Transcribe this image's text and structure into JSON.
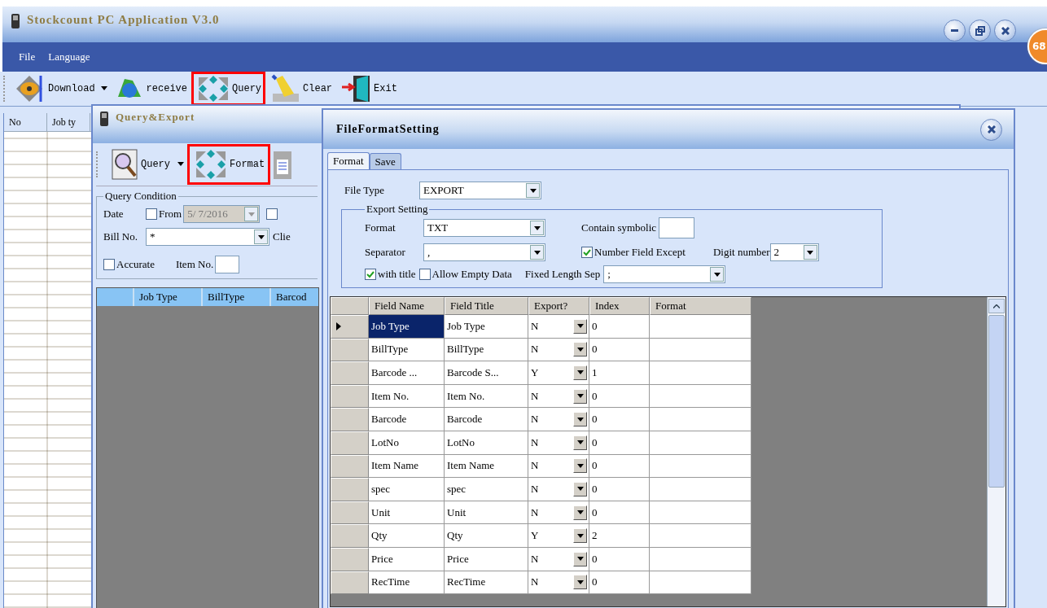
{
  "window": {
    "title": "Stockcount PC Application V3.0"
  },
  "badge": "68",
  "menu": [
    "File",
    "Language"
  ],
  "toolbar": [
    {
      "label": "Download",
      "kind": "download",
      "has_dropdown": true,
      "highlighted": false
    },
    {
      "label": "receive",
      "kind": "receive",
      "has_dropdown": false,
      "highlighted": false
    },
    {
      "label": "Query",
      "kind": "query",
      "has_dropdown": false,
      "highlighted": true
    },
    {
      "label": "Clear",
      "kind": "clear",
      "has_dropdown": false,
      "highlighted": false
    },
    {
      "label": "Exit",
      "kind": "exit",
      "has_dropdown": false,
      "highlighted": false
    }
  ],
  "main_grid": {
    "columns": [
      "No",
      "Job ty"
    ]
  },
  "query_window": {
    "title": "Query&Export",
    "toolbar": [
      {
        "label": "Query",
        "kind": "search",
        "has_dropdown": true,
        "highlighted": false
      },
      {
        "label": "Format",
        "kind": "format",
        "has_dropdown": false,
        "highlighted": true
      }
    ],
    "condition": {
      "title": "Query Condition",
      "date_label": "Date",
      "from": {
        "label": "From",
        "checked": false
      },
      "date_value": "5/ 7/2016",
      "to_checked": false,
      "bill_label": "Bill No.",
      "bill_value": "*",
      "client_label": "Clie",
      "accurate": {
        "label": "Accurate",
        "checked": false
      },
      "item_label": "Item No."
    },
    "grid_columns": [
      "Job Type",
      "BillType",
      "Barcod"
    ]
  },
  "format_window": {
    "title": "FileFormatSetting",
    "tabs": [
      {
        "label": "Format",
        "selected": true
      },
      {
        "label": "Save",
        "selected": false
      }
    ],
    "file_type_label": "File Type",
    "file_type": "EXPORT",
    "group_title": "Export Setting",
    "format_label": "Format",
    "format_value": "TXT",
    "symbolic_label": "Contain symbolic",
    "separator_label": "Separator",
    "separator_value": ",",
    "number_field": {
      "label": "Number Field Except",
      "checked": true
    },
    "digit_label": "Digit number",
    "digit_value": "2",
    "with_title": {
      "label": "with title",
      "checked": true
    },
    "allow_empty": {
      "label": "Allow Empty Data",
      "checked": false
    },
    "fixed_label": "Fixed Length Sep",
    "fixed_value": ";",
    "columns": [
      "Field Name",
      "Field Title",
      "Export?",
      "Index",
      "Format"
    ],
    "rows": [
      {
        "field_name": "Job Type",
        "field_title": "Job Type",
        "export": "N",
        "index": "0",
        "selected": true
      },
      {
        "field_name": "BillType",
        "field_title": "BillType",
        "export": "N",
        "index": "0",
        "selected": false
      },
      {
        "field_name": "Barcode ...",
        "field_title": "Barcode S...",
        "export": "Y",
        "index": "1",
        "selected": false
      },
      {
        "field_name": "Item No.",
        "field_title": "Item No.",
        "export": "N",
        "index": "0",
        "selected": false
      },
      {
        "field_name": "Barcode",
        "field_title": "Barcode",
        "export": "N",
        "index": "0",
        "selected": false
      },
      {
        "field_name": "LotNo",
        "field_title": "LotNo",
        "export": "N",
        "index": "0",
        "selected": false
      },
      {
        "field_name": "Item Name",
        "field_title": "Item Name",
        "export": "N",
        "index": "0",
        "selected": false
      },
      {
        "field_name": "spec",
        "field_title": "spec",
        "export": "N",
        "index": "0",
        "selected": false
      },
      {
        "field_name": "Unit",
        "field_title": "Unit",
        "export": "N",
        "index": "0",
        "selected": false
      },
      {
        "field_name": "Qty",
        "field_title": "Qty",
        "export": "Y",
        "index": "2",
        "selected": false
      },
      {
        "field_name": "Price",
        "field_title": "Price",
        "export": "N",
        "index": "0",
        "selected": false
      },
      {
        "field_name": "RecTime",
        "field_title": "RecTime",
        "export": "N",
        "index": "0",
        "selected": false
      }
    ]
  }
}
